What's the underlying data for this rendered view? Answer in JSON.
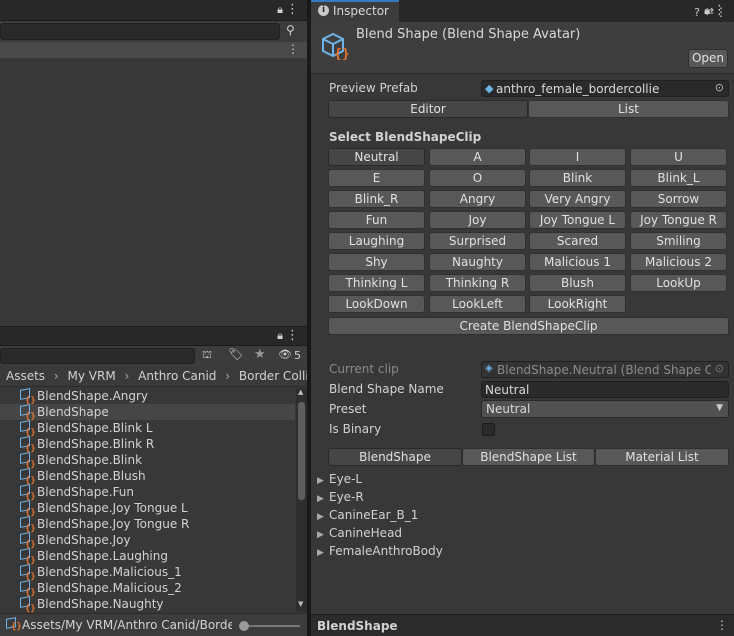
{
  "left_top": {
    "toolbar_icons": "⊦"
  },
  "project": {
    "search_value": "",
    "filter_count": "5",
    "breadcrumb": [
      "Assets",
      "My VRM",
      "Anthro Canid",
      "Border Collie"
    ],
    "items": [
      "BlendShape.Angry",
      "BlendShape",
      "BlendShape.Blink L",
      "BlendShape.Blink R",
      "BlendShape.Blink",
      "BlendShape.Blush",
      "BlendShape.Fun",
      "BlendShape.Joy Tongue L",
      "BlendShape.Joy Tongue R",
      "BlendShape.Joy",
      "BlendShape.Laughing",
      "BlendShape.Malicious_1",
      "BlendShape.Malicious_2",
      "BlendShape.Naughty"
    ],
    "selected_index": 1,
    "path_footer": "Assets/My VRM/Anthro Canid/Border C"
  },
  "inspector": {
    "tab_label": "Inspector",
    "title": "Blend Shape (Blend Shape Avatar)",
    "open_label": "Open",
    "preview_prefab_label": "Preview Prefab",
    "preview_prefab_value": "anthro_female_bordercollie",
    "mode_tabs": [
      "Editor",
      "List"
    ],
    "select_heading": "Select BlendShapeClip",
    "clips": [
      "Neutral",
      "A",
      "I",
      "U",
      "E",
      "O",
      "Blink",
      "Blink_L",
      "Blink_R",
      "Angry",
      "Very Angry",
      "Sorrow",
      "Fun",
      "Joy",
      "Joy Tongue L",
      "Joy Tongue R",
      "Laughing",
      "Surprised",
      "Scared",
      "Smiling",
      "Shy",
      "Naughty",
      "Malicious 1",
      "Malicious 2",
      "Thinking L",
      "Thinking R",
      "Blush",
      "LookUp",
      "LookDown",
      "LookLeft",
      "LookRight"
    ],
    "create_label": "Create BlendShapeClip",
    "current_clip_label": "Current clip",
    "current_clip_value": "BlendShape.Neutral (Blend Shape Clip",
    "name_label": "Blend Shape Name",
    "name_value": "Neutral",
    "preset_label": "Preset",
    "preset_value": "Neutral",
    "binary_label": "Is Binary",
    "sub_tabs": [
      "BlendShape",
      "BlendShape List",
      "Material List"
    ],
    "tree": [
      "Eye-L",
      "Eye-R",
      "CanineEar_B_1",
      "CanineHead",
      "FemaleAnthroBody"
    ],
    "footer_label": "BlendShape"
  },
  "colors": {
    "accent": "#3a79bb",
    "icon_blue": "#6fb4e8",
    "icon_orange": "#e8732c"
  }
}
